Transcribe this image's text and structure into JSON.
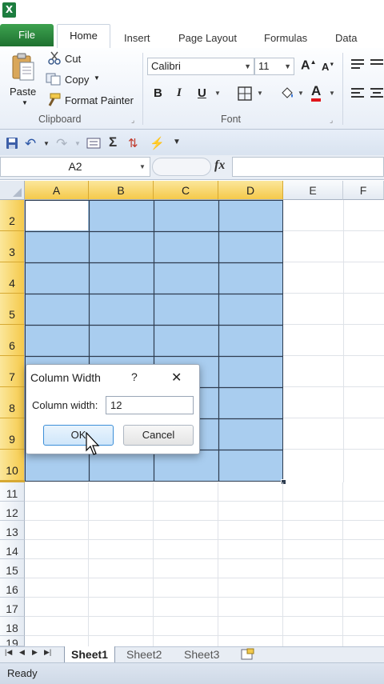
{
  "app": {
    "logo_letter": "X"
  },
  "ribbon_tabs": [
    {
      "label": "File"
    },
    {
      "label": "Home"
    },
    {
      "label": "Insert"
    },
    {
      "label": "Page Layout"
    },
    {
      "label": "Formulas"
    },
    {
      "label": "Data"
    }
  ],
  "clipboard": {
    "paste": "Paste",
    "cut": "Cut",
    "copy": "Copy",
    "format_painter": "Format Painter",
    "group_label": "Clipboard"
  },
  "font": {
    "name": "Calibri",
    "size": "11",
    "bold": "B",
    "italic": "I",
    "underline": "U",
    "grow": "A",
    "shrink": "A",
    "color_a": "A",
    "group_label": "Font"
  },
  "formula_bar": {
    "name_box": "A2",
    "fx": "fx",
    "formula": ""
  },
  "columns": [
    "A",
    "B",
    "C",
    "D",
    "E",
    "F"
  ],
  "rows": [
    "2",
    "3",
    "4",
    "5",
    "6",
    "7",
    "8",
    "9",
    "10",
    "11",
    "12",
    "13",
    "14",
    "15",
    "16",
    "17",
    "18",
    "19"
  ],
  "sheets": [
    "Sheet1",
    "Sheet2",
    "Sheet3"
  ],
  "status": {
    "text": "Ready"
  },
  "dialog": {
    "title": "Column Width",
    "help": "?",
    "close": "✕",
    "field_label": "Column width:",
    "field_value": "12",
    "ok": "OK",
    "cancel": "Cancel"
  }
}
